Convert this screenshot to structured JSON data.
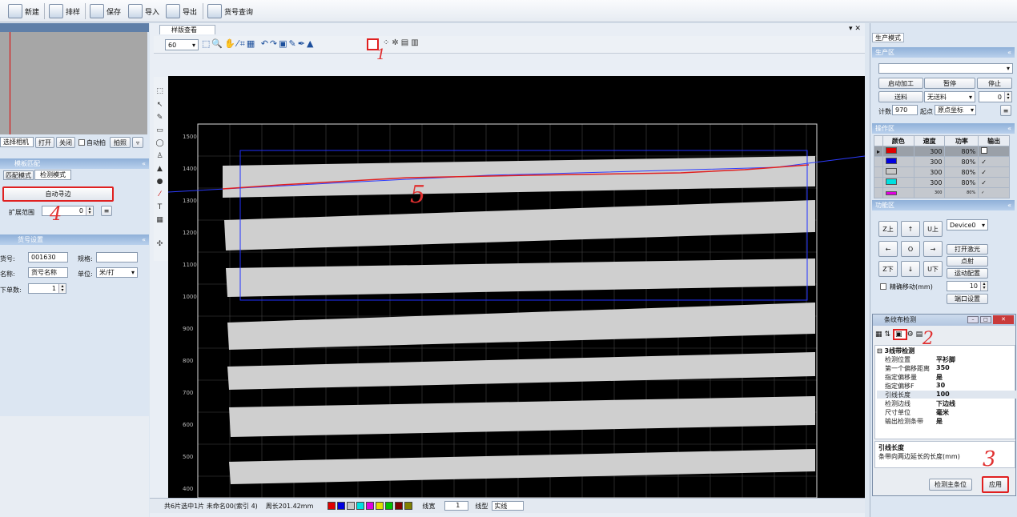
{
  "toolbar": {
    "new": "新建",
    "layout": "排样",
    "save": "保存",
    "import": "导入",
    "export": "导出",
    "query": "货号查询"
  },
  "left": {
    "preview_select": "选择相机",
    "open": "打开",
    "close": "关闭",
    "auto_shoot": "自动拍",
    "shoot": "拍照",
    "template_panel_title": "模板匹配",
    "tab_match": "匹配模式",
    "tab_detect": "检测模式",
    "auto_edge": "自动寻边",
    "expand_label": "扩展范围",
    "expand_value": "0",
    "product_panel_title": "货号设置",
    "code_label": "货号:",
    "code_value": "001630",
    "spec_label": "规格:",
    "spec_value": "",
    "name_label": "名称:",
    "name_value": "货号名称",
    "unit_label": "单位:",
    "unit_value": "米/打",
    "count_label": "下单数:",
    "count_value": "1"
  },
  "center": {
    "tab_title": "样版查看",
    "zoom": "60",
    "y_ticks": [
      "1500",
      "1400",
      "1300",
      "1200",
      "1100",
      "1000",
      "900",
      "800",
      "700",
      "600",
      "500",
      "400"
    ],
    "status_info": "共6片选中1片 未命名00(索引 4)",
    "perimeter": "周长201.42mm",
    "line_width_label": "线宽",
    "line_width_value": "1",
    "line_type_label": "线型",
    "line_type_value": "实线",
    "palette": [
      "#e00000",
      "#0000e0",
      "#c8c8c8",
      "#00e0e0",
      "#e000e0",
      "#e0e000",
      "#00c000",
      "#800000",
      "#808000"
    ]
  },
  "right": {
    "tab_title": "生产模式",
    "production_header": "生产区",
    "start": "启动加工",
    "pause": "暂停",
    "stop": "停止",
    "feed": "送料",
    "feed_mode": "无送料",
    "feed_value": "0",
    "count_label": "计数",
    "count_value": "970",
    "origin_label": "起点",
    "origin_value": "原点坐标",
    "ops_header": "操作区",
    "ops_cols": [
      "颜色",
      "速度",
      "功率",
      "输出"
    ],
    "ops_rows": [
      {
        "color": "#e00000",
        "speed": "300",
        "power": "80%",
        "out": ""
      },
      {
        "color": "#0000e0",
        "speed": "300",
        "power": "80%",
        "out": "✓"
      },
      {
        "color": "#c8c8c8",
        "speed": "300",
        "power": "80%",
        "out": "✓"
      },
      {
        "color": "#00e0e0",
        "speed": "300",
        "power": "80%",
        "out": "✓"
      },
      {
        "color": "#e000e0",
        "speed": "300",
        "power": "80%",
        "out": "✓"
      }
    ],
    "func_header": "功能区",
    "z_up": "Z上",
    "u_up": "U上",
    "z_down": "Z下",
    "u_down": "U下",
    "up": "↑",
    "down": "↓",
    "left": "←",
    "right": "→",
    "origin": "O",
    "device": "Device0",
    "laser": "打开激光",
    "spot": "点射",
    "motion": "运动配置",
    "precise": "精确移动(mm)",
    "precise_value": "10",
    "port": "端口设置",
    "dialog_title": "条纹布检测",
    "group": "3线带检测",
    "props": [
      {
        "k": "检测位置",
        "v": "平衫脚"
      },
      {
        "k": "第一个偏移距离",
        "v": "350"
      },
      {
        "k": "指定偏移量",
        "v": "是"
      },
      {
        "k": "指定偏移F",
        "v": "30"
      },
      {
        "k": "引线长度",
        "v": "100"
      },
      {
        "k": "检测边线",
        "v": "下边线"
      },
      {
        "k": "尺寸单位",
        "v": "毫米"
      },
      {
        "k": "输出检测条带",
        "v": "是"
      }
    ],
    "desc_title": "引线长度",
    "desc_text": "条带向两边延长的长度(mm)",
    "detect_strip": "检测主条位",
    "apply": "应用"
  },
  "annotations": [
    "1",
    "2",
    "3",
    "4",
    "5"
  ]
}
